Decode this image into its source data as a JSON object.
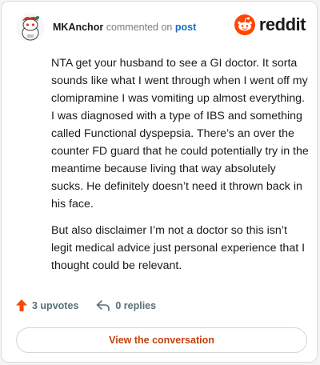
{
  "comment": {
    "author": "MKAnchor",
    "action_text": "commented on",
    "post_link": "post",
    "paragraphs": [
      "NTA get your husband to see a GI doctor. It sorta sounds like what I went through when I went off my clomipramine I was vomiting up almost everything. I was diagnosed with a type of IBS and something called Functional dyspepsia. There’s an over the counter FD guard that he could potentially try in the meantime because living that way absolutely sucks. He definitely doesn’t need it thrown back in his face.",
      "But also disclaimer I’m not a doctor so this isn’t legit medical advice just personal experience that I thought could be relevant."
    ]
  },
  "brand": {
    "name": "reddit",
    "icon": "reddit-logo-icon",
    "color": "#ff4500"
  },
  "actions": {
    "upvotes": "3 upvotes",
    "replies": "0 replies",
    "upvote_icon": "upvote-arrow-icon",
    "reply_icon": "reply-arrow-icon",
    "upvote_color": "#ff4500"
  },
  "cta": {
    "label": "View the conversation",
    "color": "#c2410c"
  }
}
